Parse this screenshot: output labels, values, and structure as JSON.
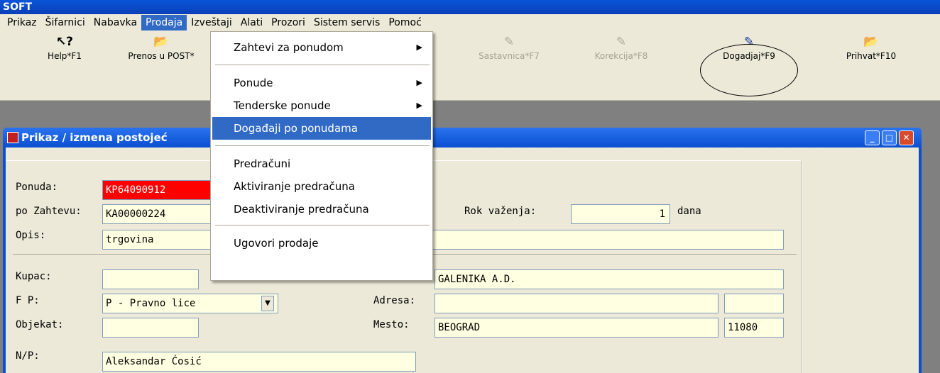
{
  "app": {
    "title": "SOFT"
  },
  "menubar": [
    "Prikaz",
    "Šifarnici",
    "Nabavka",
    "Prodaja",
    "Izveštaji",
    "Alati",
    "Prozori",
    "Sistem servis",
    "Pomoć"
  ],
  "toolbar": {
    "help": "Help*F1",
    "prenos": "Prenos u POST*",
    "sastavnica": "Sastavnica*F7",
    "korekcija": "Korekcija*F8",
    "dogadjaj": "Dogadjaj*F9",
    "prihvat": "Prihvat*F10"
  },
  "dropdown": {
    "zahtevi": "Zahtevi za ponudom",
    "ponude": "Ponude",
    "tenderske": "Tenderske ponude",
    "dogadjaji": "Događaji po ponudama",
    "predracuni": "Predračuni",
    "aktiviranje": "Aktiviranje predračuna",
    "deaktiviranje": "Deaktiviranje predračuna",
    "ugovori": "Ugovori prodaje"
  },
  "window": {
    "title": "Prikaz / izmena postojeć"
  },
  "form": {
    "ponuda_label": "Ponuda:",
    "ponuda_value": "KP64090912",
    "zahtev_label": "po Zahtevu:",
    "zahtev_value": "KA00000224",
    "rok_label": "Rok važenja:",
    "rok_value": "1",
    "rok_unit": "dana",
    "opis_label": "Opis:",
    "opis_value": "trgovina",
    "kupac_label": "Kupac:",
    "kupac_name_value": "GALENIKA A.D.",
    "fp_label": "F P:",
    "fp_value": "P - Pravno lice",
    "adresa_label": "Adresa:",
    "objekat_label": "Objekat:",
    "mesto_label": "Mesto:",
    "mesto_value": "BEOGRAD",
    "postal_value": "11080",
    "np_label": "N/P:",
    "np_value": "Aleksandar Ćosić"
  }
}
